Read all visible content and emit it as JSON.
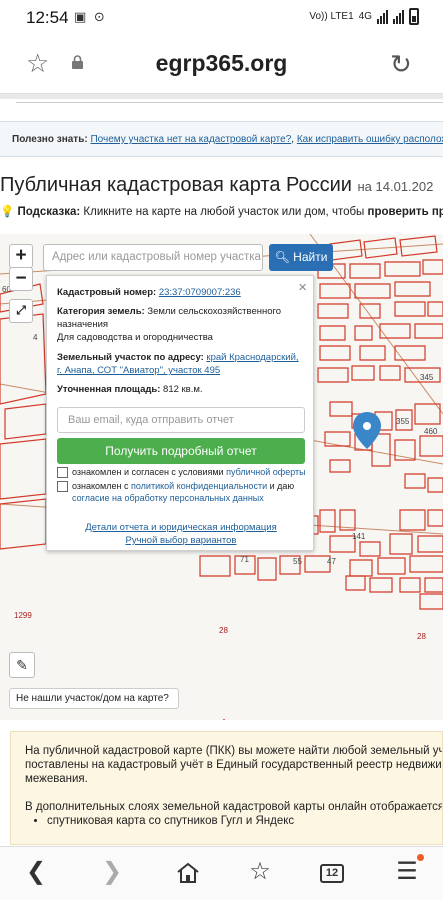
{
  "status_bar": {
    "time": "12:54",
    "network": "Vo)) LTE1",
    "signal_type": "4G"
  },
  "browser": {
    "url": "egrp365.org",
    "favorite_icon": "star-outline-icon",
    "lock_icon": "lock-icon",
    "reload_icon": "reload-icon"
  },
  "tip_bar": {
    "label": "Полезно знать:",
    "link1": "Почему участка нет на кадастровой карте?",
    "link2": "Как исправить ошибку расположения"
  },
  "page": {
    "title": "Публичная кадастровая карта России",
    "date": "на 14.01.202",
    "hint_label": "Подсказка:",
    "hint_text": "Кликните на карте на любой участок или дом, чтобы",
    "hint_bold": "проверить права с"
  },
  "map_controls": {
    "zoom_in": "+",
    "zoom_out": "−",
    "search_placeholder": "Адрес или кадастровый номер участка",
    "find_button": "Найти",
    "not_found_button": "Не нашли участок/дом на карте?"
  },
  "popup": {
    "cadastral_label": "Кадастровый номер:",
    "cadastral_value": "23:37:0709007:236",
    "category_label": "Категория земель:",
    "category_value": "Земли сельскохозяйственного назначения",
    "usage_value": "Для садоводства и огородничества",
    "address_label": "Земельный участок по адресу:",
    "address_value": "край Краснодарский, г. Анапа, СОТ \"Авиатор\", участок 495",
    "area_label": "Уточненная площадь:",
    "area_value": "812 кв.м.",
    "email_placeholder": "Ваш email, куда отправить отчет",
    "get_report_button": "Получить подробный отчет",
    "consent1_text": "ознакомлен и согласен с условиями",
    "consent1_link": "публичной оферты",
    "consent2_text": "ознакомлен с",
    "consent2_link": "политикой конфиденциальности",
    "consent2_tail": "и даю",
    "consent2_link2": "согласие на обработку персональных данных",
    "details_link": "Детали отчета и юридическая информация",
    "manual_link": "Ручной выбор вариантов"
  },
  "map_labels": [
    "60",
    "4",
    "345",
    "355",
    "460",
    "141",
    "71",
    "55",
    "47",
    "1299",
    "28",
    "28"
  ],
  "info": {
    "line1": "На публичной кадастровой карте (ПКК) вы можете найти любой земельный участ",
    "line2": "поставлены на кадастровый учёт в Единый государственный реестр недвижимос",
    "line3": "межевания.",
    "line4": "В дополнительных слоях земельной кадастровой карты онлайн отображается:",
    "bullet1": "спутниковая карта со спутников Гугл и Яндекс"
  },
  "navbar": {
    "tab_count": "12"
  },
  "colors": {
    "accent_blue": "#2a6fb3",
    "green_button": "#4cae4c",
    "parcel_red": "#d23a2a",
    "marker_blue": "#3a86c8"
  }
}
